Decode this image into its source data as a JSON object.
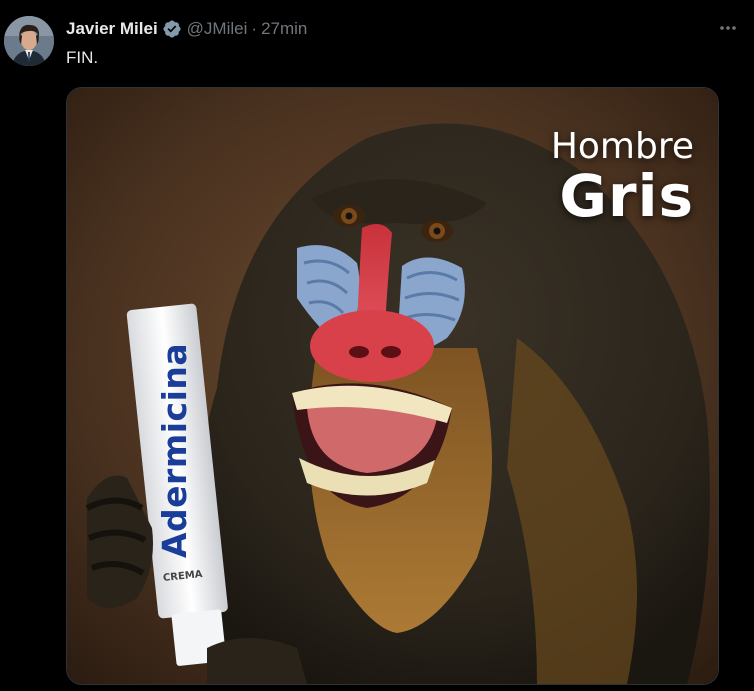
{
  "tweet": {
    "author_name": "Javier Milei",
    "handle": "@JMilei",
    "separator": "·",
    "time": "27min",
    "text": "FIN.",
    "verified_icon": "verified-badge-icon",
    "more_icon": "more-options-icon",
    "accent_color": "#1d9bf0"
  },
  "media": {
    "caption_line1": "Hombre",
    "caption_line2": "Gris",
    "product_brand": "Adermicina",
    "product_type": "CREMA"
  }
}
